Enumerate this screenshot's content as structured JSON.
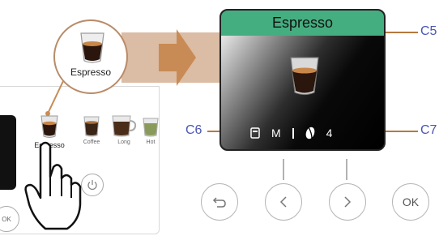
{
  "screen": {
    "title": "Espresso",
    "status": {
      "size": "M",
      "aroma_level": "4"
    }
  },
  "callouts": {
    "c5": "C5",
    "c6": "C6",
    "c7": "C7"
  },
  "bubble": {
    "label": "Espresso"
  },
  "panel": {
    "drinks": [
      {
        "label": "Espresso"
      },
      {
        "label": "Coffee"
      },
      {
        "label": "Long"
      },
      {
        "label": "Hot"
      }
    ],
    "ok_label": "OK"
  },
  "nav": {
    "ok_label": "OK"
  },
  "colors": {
    "title_bar": "#45ae80",
    "callout_text": "#4a55b5",
    "leader_line": "#b8783e",
    "accent_beam": "#dbbca4",
    "arrow": "#c98b55"
  }
}
